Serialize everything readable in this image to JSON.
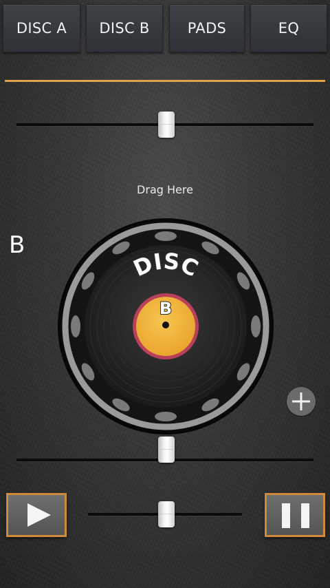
{
  "tabs": [
    "DISC A",
    "DISC B",
    "PADS",
    "EQ"
  ],
  "drag_hint": "Drag Here",
  "deck_letter": "B",
  "disc": {
    "label_text": "DISC",
    "label_letter": "B"
  },
  "sliders": {
    "top_position": 0.5,
    "bottom_position": 0.5,
    "transport_position": 0.5
  },
  "colors": {
    "accent": "#e0a24a",
    "button_border": "#d08a3c",
    "label_yellow": "#f2b43a",
    "label_ring": "#b8405a"
  },
  "icons": {
    "plus": "plus-icon",
    "play": "play-icon",
    "pause": "pause-icon"
  }
}
